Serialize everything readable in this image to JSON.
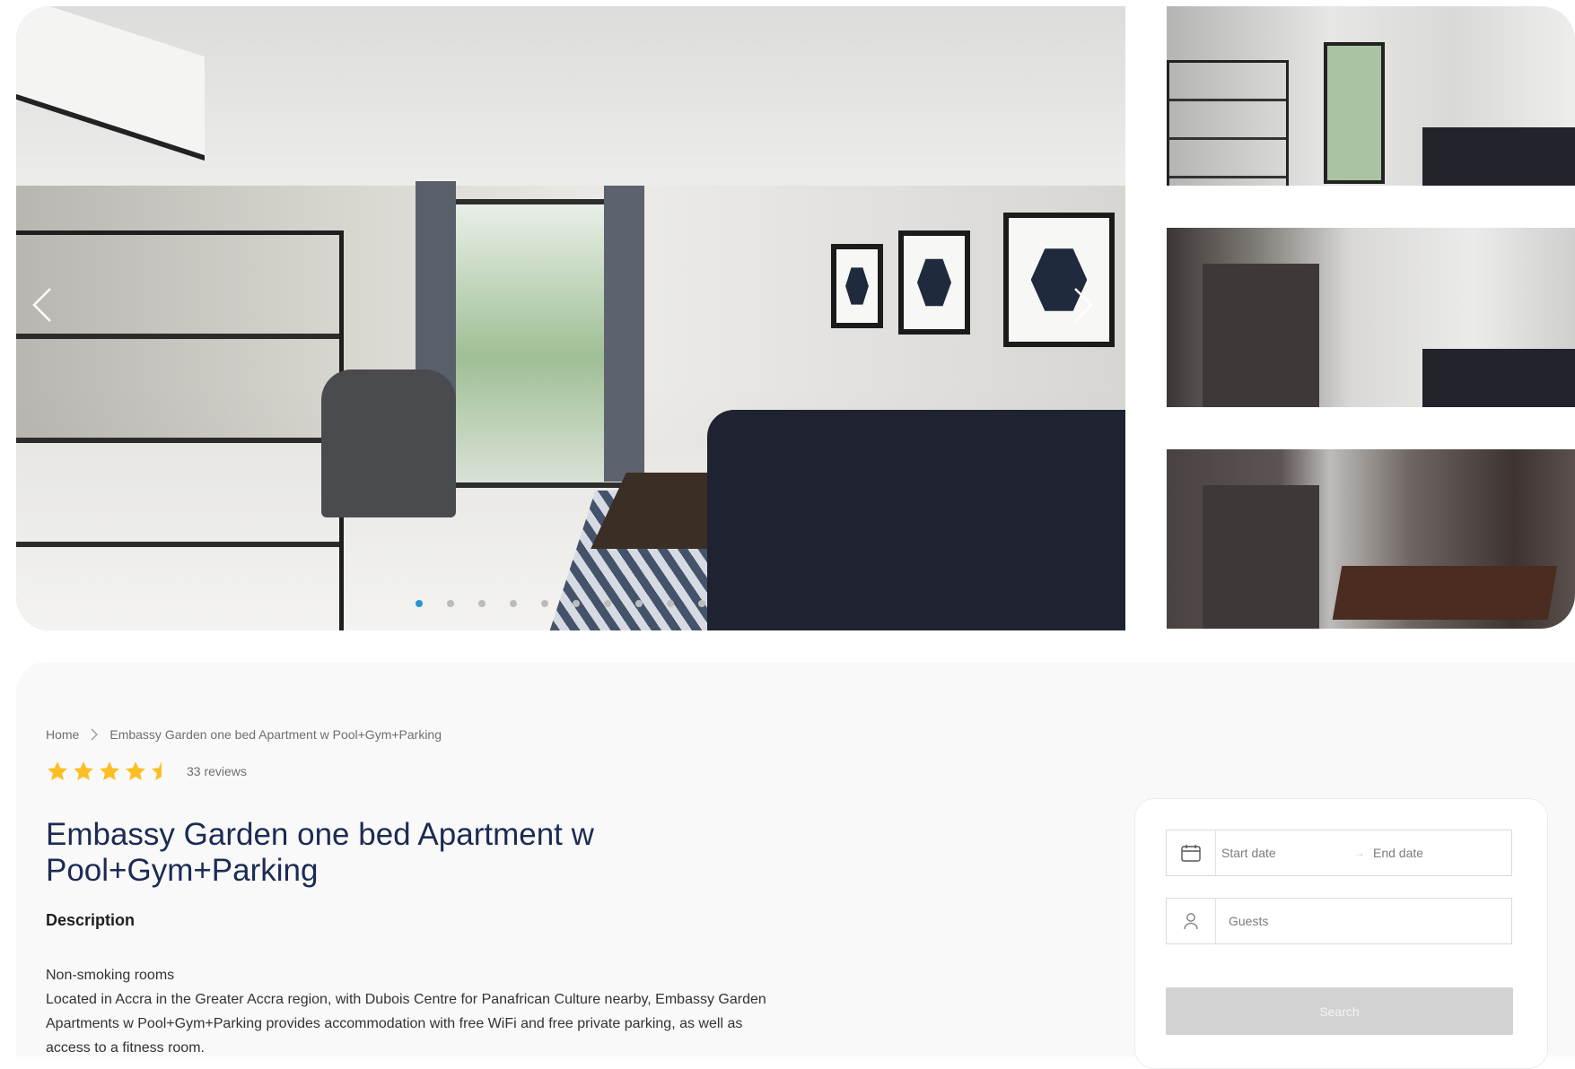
{
  "gallery": {
    "main_image_alt": "Living room",
    "slide_count": 10,
    "active_slide": 1,
    "thumbnails": [
      "Living room",
      "Kitchen and living area",
      "Kitchen and dining"
    ]
  },
  "breadcrumb": {
    "home": "Home",
    "current": "Embassy Garden one bed Apartment w Pool+Gym+Parking"
  },
  "rating": {
    "stars": 4.5,
    "reviews": "33 reviews"
  },
  "listing": {
    "title": "Embassy Garden one bed Apartment w Pool+Gym+Parking",
    "description_label": "Description",
    "description_lines": [
      "Non-smoking rooms",
      "Located in Accra in the Greater Accra region, with Dubois Centre for Panafrican Culture nearby, Embassy Garden Apartments w Pool+Gym+Parking provides accommodation with free WiFi and free private parking, as well as access to a fitness room."
    ]
  },
  "booking": {
    "start_placeholder": "Start date",
    "range_separator": "→",
    "end_placeholder": "End date",
    "guests_placeholder": "Guests",
    "search_label": "Search"
  },
  "colors": {
    "title": "#1c2b54",
    "star": "#fbbf24",
    "dot_active": "#2793d6",
    "search_disabled": "#d2d2d2"
  }
}
